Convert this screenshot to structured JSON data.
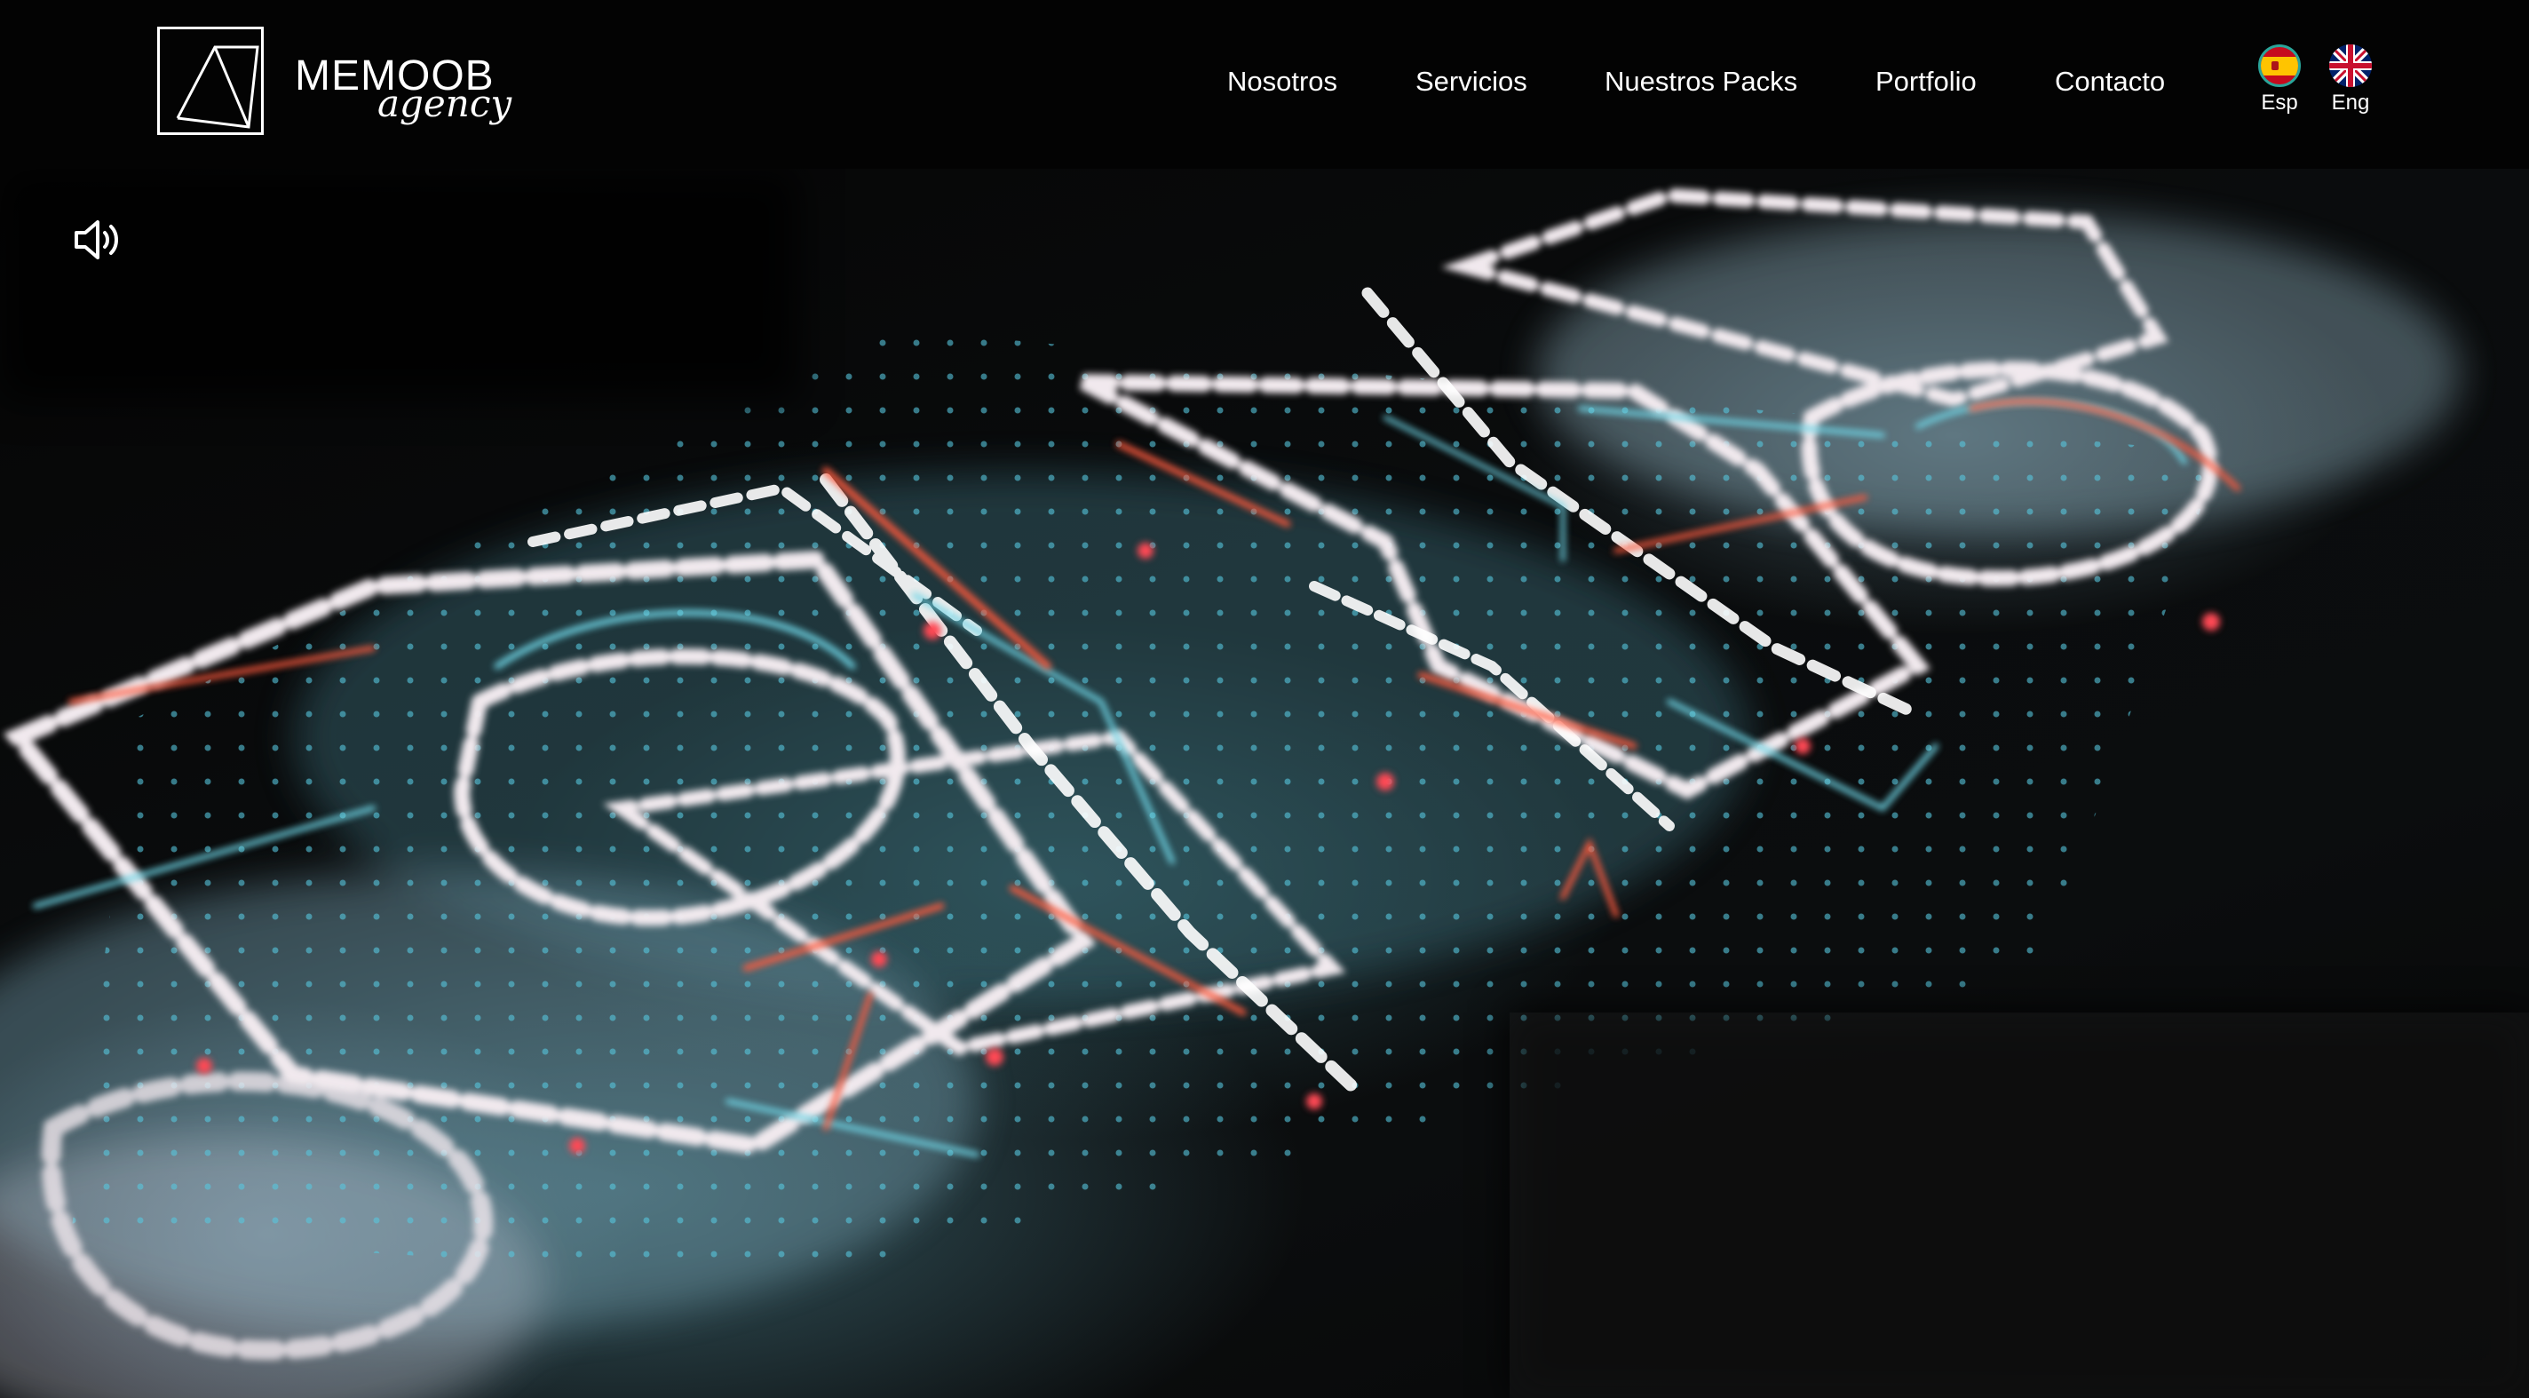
{
  "brand": {
    "name_prefix": "ME",
    "name_main": "MOOB",
    "tagline": "agency"
  },
  "nav": {
    "items": [
      {
        "label": "Nosotros"
      },
      {
        "label": "Servicios"
      },
      {
        "label": "Nuestros Packs"
      },
      {
        "label": "Portfolio"
      },
      {
        "label": "Contacto"
      }
    ]
  },
  "languages": [
    {
      "label": "Esp",
      "icon": "spain-flag-icon",
      "active": true
    },
    {
      "label": "Eng",
      "icon": "uk-flag-icon",
      "active": false
    }
  ],
  "hero": {
    "sound_icon": "speaker-volume-icon",
    "colors": {
      "cyan": "#6fd6e6",
      "red": "#ff5a3c",
      "white": "#f4eef0"
    }
  }
}
